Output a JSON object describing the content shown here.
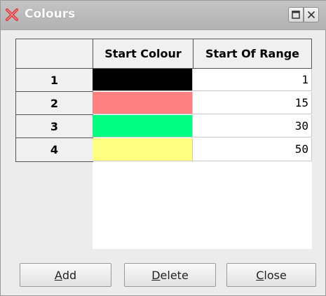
{
  "window": {
    "title": "Colours"
  },
  "table": {
    "columns": [
      "Start Colour",
      "Start Of Range"
    ],
    "rows": [
      {
        "index": "1",
        "colour": "#000000",
        "start": "1"
      },
      {
        "index": "2",
        "colour": "#ff8080",
        "start": "15"
      },
      {
        "index": "3",
        "colour": "#00ff80",
        "start": "30"
      },
      {
        "index": "4",
        "colour": "#ffff80",
        "start": "50"
      }
    ]
  },
  "buttons": {
    "add": {
      "mnemonic": "A",
      "rest": "dd"
    },
    "delete": {
      "mnemonic": "D",
      "rest": "elete"
    },
    "close": {
      "mnemonic": "C",
      "rest": "lose"
    }
  },
  "icons": {
    "app": "x-icon",
    "maximize": "maximize-icon",
    "close": "close-icon"
  }
}
